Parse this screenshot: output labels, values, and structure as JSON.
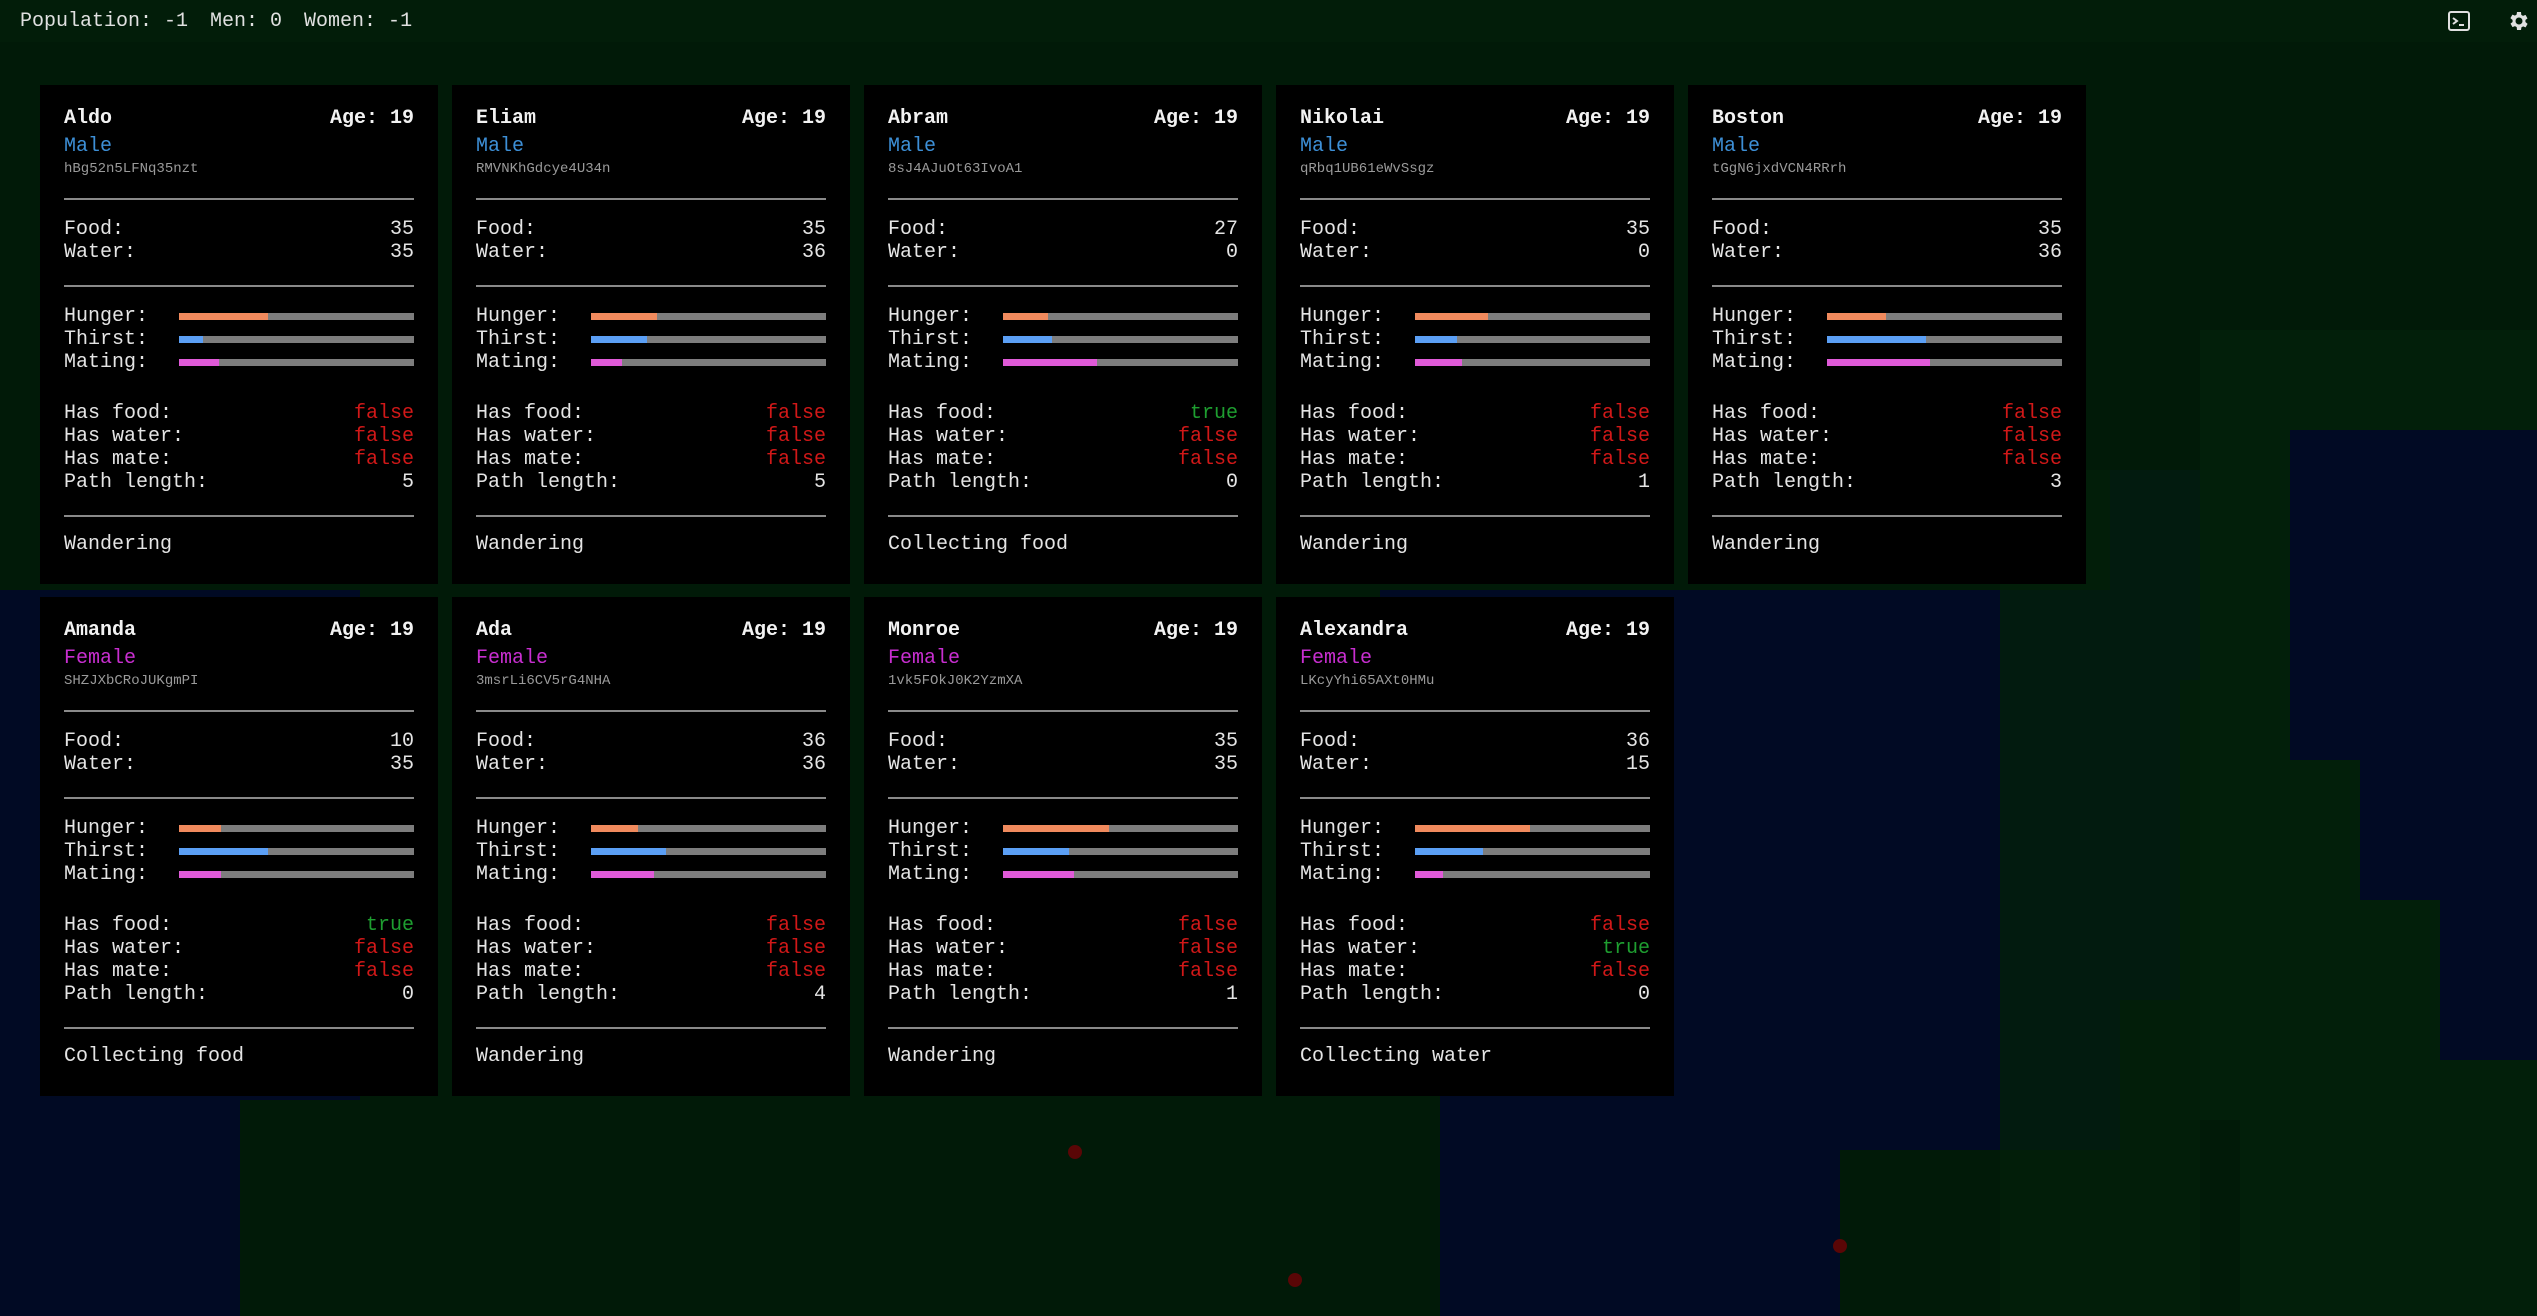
{
  "topbar": {
    "population": "Population: -1",
    "men": "Men: 0",
    "women": "Women: -1"
  },
  "labels": {
    "food": "Food:",
    "water": "Water:",
    "hunger": "Hunger:",
    "thirst": "Thirst:",
    "mating": "Mating:",
    "has_food": "Has food:",
    "has_water": "Has water:",
    "has_mate": "Has mate:",
    "path_length": "Path length:"
  },
  "colors": {
    "hunger": "#f08a5d",
    "thirst": "#5b9ff5",
    "mating": "#e05ad8",
    "male": "#3d8fd6",
    "female": "#c82ed0",
    "true": "#1e9e30",
    "false": "#d11818"
  },
  "icons": [
    "terminal-icon",
    "gear-icon"
  ],
  "cards": [
    {
      "name": "Aldo",
      "age": "Age: 19",
      "gender": "Male",
      "id": "hBg52n5LFNq35nzt",
      "food": "35",
      "water": "35",
      "hunger": 0.38,
      "thirst": 0.1,
      "mating": 0.17,
      "has_food": "false",
      "has_water": "false",
      "has_mate": "false",
      "path_length": "5",
      "status": "Wandering"
    },
    {
      "name": "Eliam",
      "age": "Age: 19",
      "gender": "Male",
      "id": "RMVNKhGdcye4U34n",
      "food": "35",
      "water": "36",
      "hunger": 0.28,
      "thirst": 0.24,
      "mating": 0.13,
      "has_food": "false",
      "has_water": "false",
      "has_mate": "false",
      "path_length": "5",
      "status": "Wandering"
    },
    {
      "name": "Abram",
      "age": "Age: 19",
      "gender": "Male",
      "id": "8sJ4AJuOt63IvoA1",
      "food": "27",
      "water": "0",
      "hunger": 0.19,
      "thirst": 0.21,
      "mating": 0.4,
      "has_food": "true",
      "has_water": "false",
      "has_mate": "false",
      "path_length": "0",
      "status": "Collecting food"
    },
    {
      "name": "Nikolai",
      "age": "Age: 19",
      "gender": "Male",
      "id": "qRbq1UB61eWvSsgz",
      "food": "35",
      "water": "0",
      "hunger": 0.31,
      "thirst": 0.18,
      "mating": 0.2,
      "has_food": "false",
      "has_water": "false",
      "has_mate": "false",
      "path_length": "1",
      "status": "Wandering"
    },
    {
      "name": "Boston",
      "age": "Age: 19",
      "gender": "Male",
      "id": "tGgN6jxdVCN4RRrh",
      "food": "35",
      "water": "36",
      "hunger": 0.25,
      "thirst": 0.42,
      "mating": 0.44,
      "has_food": "false",
      "has_water": "false",
      "has_mate": "false",
      "path_length": "3",
      "status": "Wandering"
    },
    {
      "name": "Amanda",
      "age": "Age: 19",
      "gender": "Female",
      "id": "SHZJXbCRoJUKgmPI",
      "food": "10",
      "water": "35",
      "hunger": 0.18,
      "thirst": 0.38,
      "mating": 0.18,
      "has_food": "true",
      "has_water": "false",
      "has_mate": "false",
      "path_length": "0",
      "status": "Collecting food"
    },
    {
      "name": "Ada",
      "age": "Age: 19",
      "gender": "Female",
      "id": "3msrLi6CV5rG4NHA",
      "food": "36",
      "water": "36",
      "hunger": 0.2,
      "thirst": 0.32,
      "mating": 0.27,
      "has_food": "false",
      "has_water": "false",
      "has_mate": "false",
      "path_length": "4",
      "status": "Wandering"
    },
    {
      "name": "Monroe",
      "age": "Age: 19",
      "gender": "Female",
      "id": "1vk5FOkJ0K2YzmXA",
      "food": "35",
      "water": "35",
      "hunger": 0.45,
      "thirst": 0.28,
      "mating": 0.3,
      "has_food": "false",
      "has_water": "false",
      "has_mate": "false",
      "path_length": "1",
      "status": "Wandering"
    },
    {
      "name": "Alexandra",
      "age": "Age: 19",
      "gender": "Female",
      "id": "LKcyYhi65AXt0HMu",
      "food": "36",
      "water": "15",
      "hunger": 0.49,
      "thirst": 0.29,
      "mating": 0.12,
      "has_food": "false",
      "has_water": "true",
      "has_mate": "false",
      "path_length": "0",
      "status": "Collecting water"
    }
  ]
}
